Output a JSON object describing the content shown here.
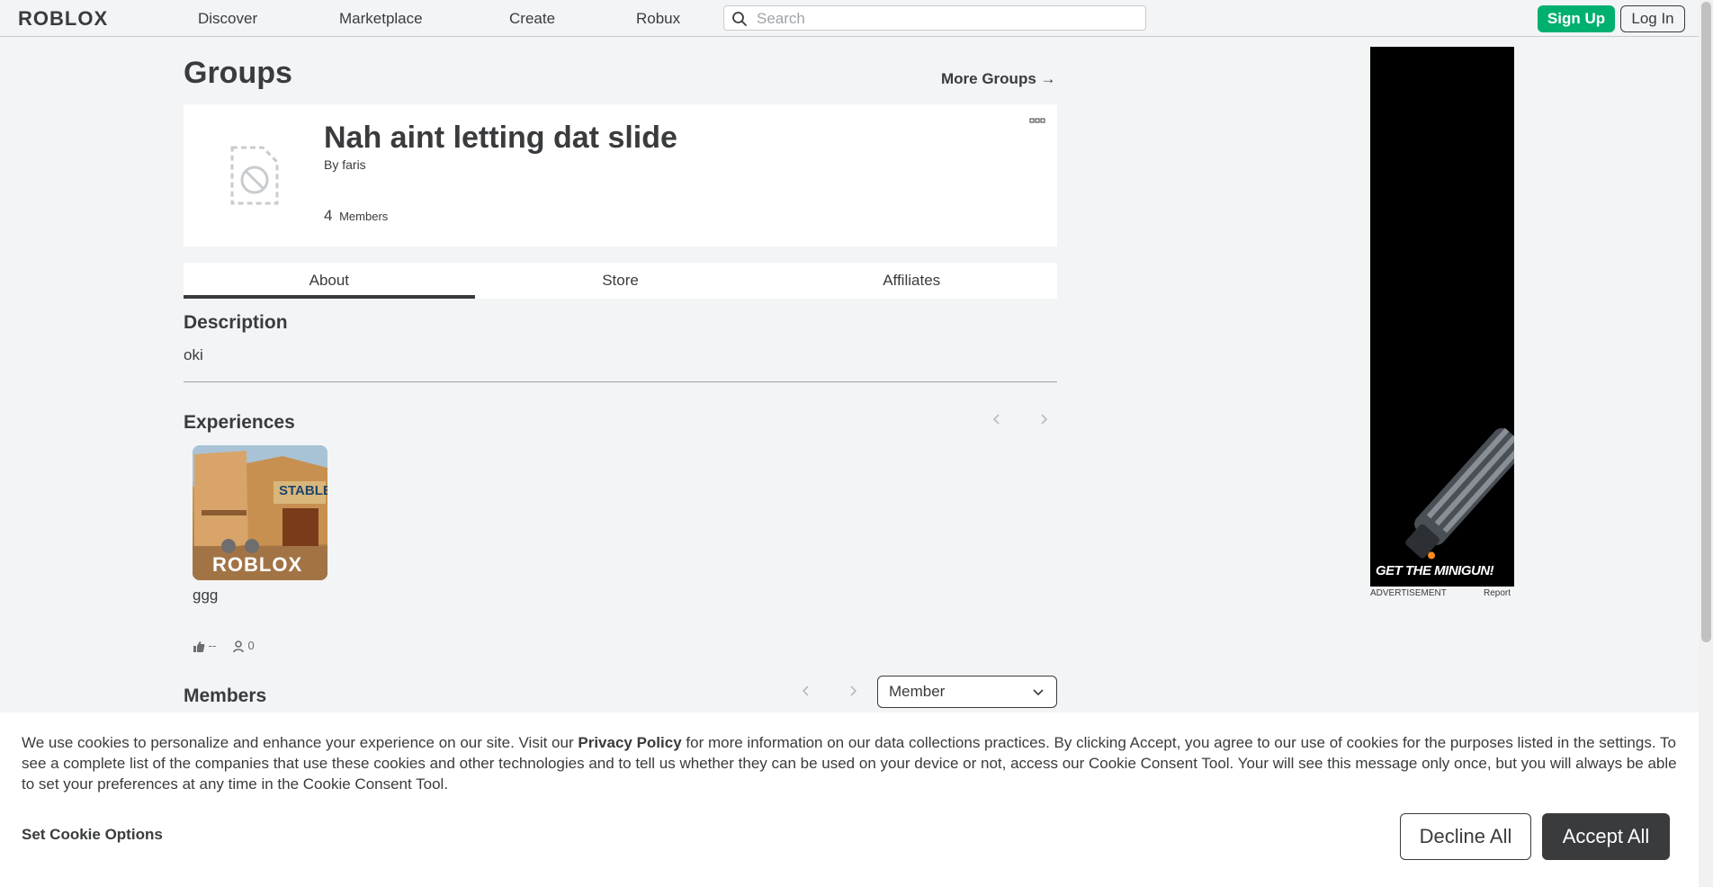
{
  "header": {
    "logo": "ROBLOX",
    "nav": [
      "Discover",
      "Marketplace",
      "Create",
      "Robux"
    ],
    "search_placeholder": "Search",
    "signup_label": "Sign Up",
    "login_label": "Log In"
  },
  "page": {
    "title": "Groups",
    "more_groups": "More Groups →"
  },
  "group": {
    "name": "Nah aint letting dat slide",
    "by_label": "By",
    "owner": "faris",
    "member_count": "4",
    "members_label": "Members"
  },
  "tabs": [
    {
      "label": "About",
      "active": true
    },
    {
      "label": "Store",
      "active": false
    },
    {
      "label": "Affiliates",
      "active": false
    }
  ],
  "description": {
    "title": "Description",
    "text": "oki"
  },
  "experiences": {
    "title": "Experiences",
    "items": [
      {
        "name": "ggg",
        "thumb_text": "ROBLOX",
        "sign_text": "STABLE",
        "likes": "--",
        "players": "0"
      }
    ]
  },
  "members": {
    "title": "Members",
    "role_selected": "Member"
  },
  "ad": {
    "headline": "GET THE MINIGUN!",
    "label": "ADVERTISEMENT",
    "report": "Report"
  },
  "cookie": {
    "text_before": "We use cookies to personalize and enhance your experience on our site. Visit our ",
    "policy_link": "Privacy Policy",
    "text_after": " for more information on our data collections practices. By clicking Accept, you agree to our use of cookies for the purposes listed in the settings. To see a complete list of the companies that use these cookies and other technologies and to tell us whether they can be used on your device or not, access our Cookie Consent Tool. Your will see this message only once, but you will always be able to set your preferences at any time in the Cookie Consent Tool.",
    "options_label": "Set Cookie Options",
    "decline_label": "Decline All",
    "accept_label": "Accept All"
  },
  "colors": {
    "accent_green": "#00b06f",
    "text_dark": "#393b3d",
    "background": "#f2f4f5"
  }
}
